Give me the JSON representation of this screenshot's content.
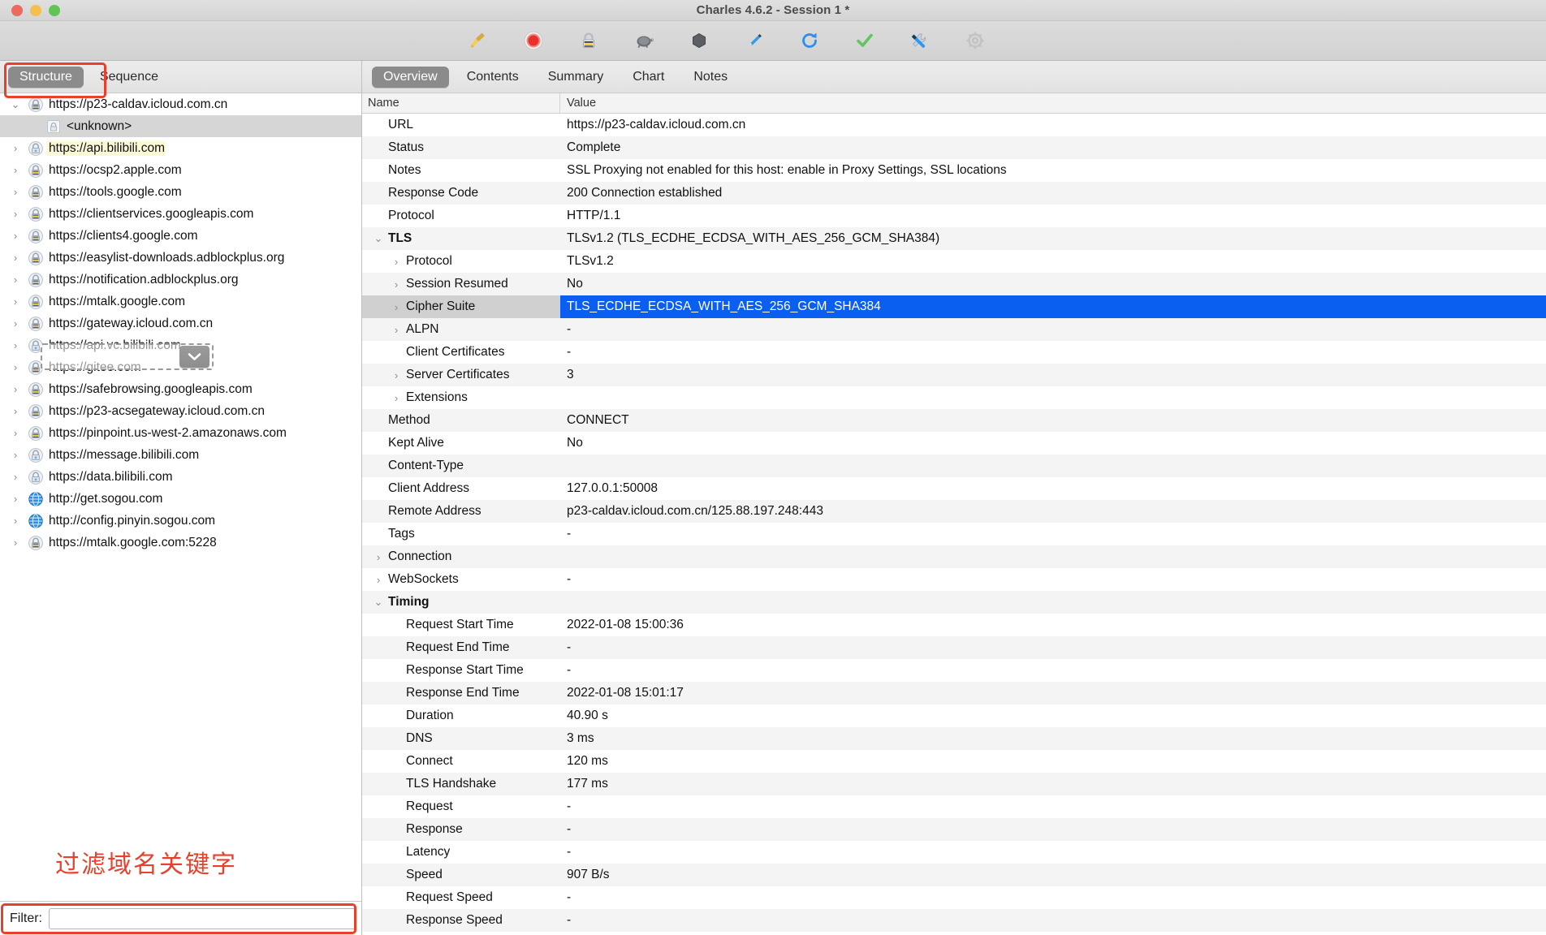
{
  "window": {
    "title": "Charles 4.6.2 - Session 1 *",
    "traffic_lights": [
      "close",
      "minimize",
      "zoom"
    ]
  },
  "toolbar": {
    "buttons": [
      {
        "name": "clear-session-icon",
        "label": "Clear"
      },
      {
        "name": "record-icon",
        "label": "Start/Stop Recording"
      },
      {
        "name": "ssl-proxying-icon",
        "label": "SSL Proxying"
      },
      {
        "name": "throttle-turtle-icon",
        "label": "Throttling"
      },
      {
        "name": "breakpoints-icon",
        "label": "Breakpoints"
      },
      {
        "name": "compose-icon",
        "label": "Compose"
      },
      {
        "name": "repeat-icon",
        "label": "Repeat"
      },
      {
        "name": "validate-icon",
        "label": "Validate"
      },
      {
        "name": "tools-icon",
        "label": "Tools"
      },
      {
        "name": "settings-gear-icon",
        "label": "Settings"
      }
    ]
  },
  "left_pane": {
    "tabs": [
      {
        "label": "Structure",
        "active": true
      },
      {
        "label": "Sequence",
        "active": false
      }
    ],
    "annotation_note": "过滤域名关键字",
    "filter": {
      "label": "Filter:",
      "value": "",
      "placeholder": ""
    },
    "tree": [
      {
        "label": "https://p23-caldav.icloud.com.cn",
        "icon": "lock-icon",
        "twisty": "expanded",
        "level": 0,
        "selected": false,
        "highlight": false
      },
      {
        "label": "<unknown>",
        "icon": "lock-plain-icon",
        "twisty": "none",
        "level": 1,
        "selected": true,
        "highlight": false
      },
      {
        "label": "https://api.bilibili.com",
        "icon": "lock-bolt-icon",
        "twisty": "collapsed",
        "level": 0,
        "selected": false,
        "highlight": true
      },
      {
        "label": "https://ocsp2.apple.com",
        "icon": "lock-icon",
        "twisty": "collapsed",
        "level": 0,
        "selected": false,
        "highlight": false
      },
      {
        "label": "https://tools.google.com",
        "icon": "lock-icon",
        "twisty": "collapsed",
        "level": 0,
        "selected": false,
        "highlight": false
      },
      {
        "label": "https://clientservices.googleapis.com",
        "icon": "lock-icon",
        "twisty": "collapsed",
        "level": 0,
        "selected": false,
        "highlight": false
      },
      {
        "label": "https://clients4.google.com",
        "icon": "lock-icon",
        "twisty": "collapsed",
        "level": 0,
        "selected": false,
        "highlight": false
      },
      {
        "label": "https://easylist-downloads.adblockplus.org",
        "icon": "lock-icon",
        "twisty": "collapsed",
        "level": 0,
        "selected": false,
        "highlight": false
      },
      {
        "label": "https://notification.adblockplus.org",
        "icon": "lock-icon",
        "twisty": "collapsed",
        "level": 0,
        "selected": false,
        "highlight": false
      },
      {
        "label": "https://mtalk.google.com",
        "icon": "lock-icon",
        "twisty": "collapsed",
        "level": 0,
        "selected": false,
        "highlight": false
      },
      {
        "label": "https://gateway.icloud.com.cn",
        "icon": "lock-icon",
        "twisty": "collapsed",
        "level": 0,
        "selected": false,
        "highlight": false
      },
      {
        "label": "https://api.vc.bilibili.com",
        "icon": "lock-bolt-icon",
        "twisty": "collapsed",
        "level": 0,
        "selected": false,
        "highlight": false
      },
      {
        "label": "https://gitee.com",
        "icon": "lock-icon",
        "twisty": "collapsed",
        "level": 0,
        "selected": false,
        "highlight": false
      },
      {
        "label": "https://safebrowsing.googleapis.com",
        "icon": "lock-icon",
        "twisty": "collapsed",
        "level": 0,
        "selected": false,
        "highlight": false
      },
      {
        "label": "https://p23-acsegateway.icloud.com.cn",
        "icon": "lock-icon",
        "twisty": "collapsed",
        "level": 0,
        "selected": false,
        "highlight": false
      },
      {
        "label": "https://pinpoint.us-west-2.amazonaws.com",
        "icon": "lock-icon",
        "twisty": "collapsed",
        "level": 0,
        "selected": false,
        "highlight": false
      },
      {
        "label": "https://message.bilibili.com",
        "icon": "lock-bolt-icon",
        "twisty": "collapsed",
        "level": 0,
        "selected": false,
        "highlight": false
      },
      {
        "label": "https://data.bilibili.com",
        "icon": "lock-bolt-icon",
        "twisty": "collapsed",
        "level": 0,
        "selected": false,
        "highlight": false
      },
      {
        "label": "http://get.sogou.com",
        "icon": "globe-icon",
        "twisty": "collapsed",
        "level": 0,
        "selected": false,
        "highlight": false
      },
      {
        "label": "http://config.pinyin.sogou.com",
        "icon": "globe-icon",
        "twisty": "collapsed",
        "level": 0,
        "selected": false,
        "highlight": false
      },
      {
        "label": "https://mtalk.google.com:5228",
        "icon": "lock-icon",
        "twisty": "collapsed",
        "level": 0,
        "selected": false,
        "highlight": false
      }
    ],
    "dropdown_overlay": {
      "attached_to": "https://mtalk.google.com",
      "icon": "chevron-down-icon"
    }
  },
  "right_pane": {
    "tabs": [
      {
        "label": "Overview",
        "active": true
      },
      {
        "label": "Contents",
        "active": false
      },
      {
        "label": "Summary",
        "active": false
      },
      {
        "label": "Chart",
        "active": false
      },
      {
        "label": "Notes",
        "active": false
      }
    ],
    "columns": {
      "name": "Name",
      "value": "Value"
    },
    "rows": [
      {
        "name": "URL",
        "value": "https://p23-caldav.icloud.com.cn",
        "level": 0,
        "twisty": "none",
        "bold": false,
        "selected": false
      },
      {
        "name": "Status",
        "value": "Complete",
        "level": 0,
        "twisty": "none",
        "bold": false,
        "selected": false
      },
      {
        "name": "Notes",
        "value": "SSL Proxying not enabled for this host: enable in Proxy Settings, SSL locations",
        "level": 0,
        "twisty": "none",
        "bold": false,
        "selected": false
      },
      {
        "name": "Response Code",
        "value": "200 Connection established",
        "level": 0,
        "twisty": "none",
        "bold": false,
        "selected": false
      },
      {
        "name": "Protocol",
        "value": "HTTP/1.1",
        "level": 0,
        "twisty": "none",
        "bold": false,
        "selected": false
      },
      {
        "name": "TLS",
        "value": "TLSv1.2 (TLS_ECDHE_ECDSA_WITH_AES_256_GCM_SHA384)",
        "level": 0,
        "twisty": "expanded",
        "bold": true,
        "selected": false
      },
      {
        "name": "Protocol",
        "value": "TLSv1.2",
        "level": 1,
        "twisty": "collapsed",
        "bold": false,
        "selected": false
      },
      {
        "name": "Session Resumed",
        "value": "No",
        "level": 1,
        "twisty": "collapsed",
        "bold": false,
        "selected": false
      },
      {
        "name": "Cipher Suite",
        "value": "TLS_ECDHE_ECDSA_WITH_AES_256_GCM_SHA384",
        "level": 1,
        "twisty": "collapsed",
        "bold": false,
        "selected": true
      },
      {
        "name": "ALPN",
        "value": "-",
        "level": 1,
        "twisty": "collapsed",
        "bold": false,
        "selected": false
      },
      {
        "name": "Client Certificates",
        "value": "-",
        "level": 1,
        "twisty": "none",
        "bold": false,
        "selected": false
      },
      {
        "name": "Server Certificates",
        "value": "3",
        "level": 1,
        "twisty": "collapsed",
        "bold": false,
        "selected": false
      },
      {
        "name": "Extensions",
        "value": "",
        "level": 1,
        "twisty": "collapsed",
        "bold": false,
        "selected": false
      },
      {
        "name": "Method",
        "value": "CONNECT",
        "level": 0,
        "twisty": "none",
        "bold": false,
        "selected": false
      },
      {
        "name": "Kept Alive",
        "value": "No",
        "level": 0,
        "twisty": "none",
        "bold": false,
        "selected": false
      },
      {
        "name": "Content-Type",
        "value": "",
        "level": 0,
        "twisty": "none",
        "bold": false,
        "selected": false
      },
      {
        "name": "Client Address",
        "value": "127.0.0.1:50008",
        "level": 0,
        "twisty": "none",
        "bold": false,
        "selected": false
      },
      {
        "name": "Remote Address",
        "value": "p23-caldav.icloud.com.cn/125.88.197.248:443",
        "level": 0,
        "twisty": "none",
        "bold": false,
        "selected": false
      },
      {
        "name": "Tags",
        "value": "-",
        "level": 0,
        "twisty": "none",
        "bold": false,
        "selected": false
      },
      {
        "name": "Connection",
        "value": "",
        "level": 0,
        "twisty": "collapsed",
        "bold": false,
        "selected": false
      },
      {
        "name": "WebSockets",
        "value": "-",
        "level": 0,
        "twisty": "collapsed",
        "bold": false,
        "selected": false
      },
      {
        "name": "Timing",
        "value": "",
        "level": 0,
        "twisty": "expanded",
        "bold": true,
        "selected": false
      },
      {
        "name": "Request Start Time",
        "value": "2022-01-08 15:00:36",
        "level": 1,
        "twisty": "none",
        "bold": false,
        "selected": false
      },
      {
        "name": "Request End Time",
        "value": "-",
        "level": 1,
        "twisty": "none",
        "bold": false,
        "selected": false
      },
      {
        "name": "Response Start Time",
        "value": "-",
        "level": 1,
        "twisty": "none",
        "bold": false,
        "selected": false
      },
      {
        "name": "Response End Time",
        "value": "2022-01-08 15:01:17",
        "level": 1,
        "twisty": "none",
        "bold": false,
        "selected": false
      },
      {
        "name": "Duration",
        "value": "40.90 s",
        "level": 1,
        "twisty": "none",
        "bold": false,
        "selected": false
      },
      {
        "name": "DNS",
        "value": "3 ms",
        "level": 1,
        "twisty": "none",
        "bold": false,
        "selected": false
      },
      {
        "name": "Connect",
        "value": "120 ms",
        "level": 1,
        "twisty": "none",
        "bold": false,
        "selected": false
      },
      {
        "name": "TLS Handshake",
        "value": "177 ms",
        "level": 1,
        "twisty": "none",
        "bold": false,
        "selected": false
      },
      {
        "name": "Request",
        "value": "-",
        "level": 1,
        "twisty": "none",
        "bold": false,
        "selected": false
      },
      {
        "name": "Response",
        "value": "-",
        "level": 1,
        "twisty": "none",
        "bold": false,
        "selected": false
      },
      {
        "name": "Latency",
        "value": "-",
        "level": 1,
        "twisty": "none",
        "bold": false,
        "selected": false
      },
      {
        "name": "Speed",
        "value": "907 B/s",
        "level": 1,
        "twisty": "none",
        "bold": false,
        "selected": false
      },
      {
        "name": "Request Speed",
        "value": "-",
        "level": 1,
        "twisty": "none",
        "bold": false,
        "selected": false
      },
      {
        "name": "Response Speed",
        "value": "-",
        "level": 1,
        "twisty": "none",
        "bold": false,
        "selected": false
      }
    ]
  },
  "colors": {
    "selection_blue": "#0b5ff0",
    "annotation_red": "#e8402a",
    "highlight_yellow": "#fbf8d6",
    "tab_active_gray": "#8b8b8b"
  }
}
